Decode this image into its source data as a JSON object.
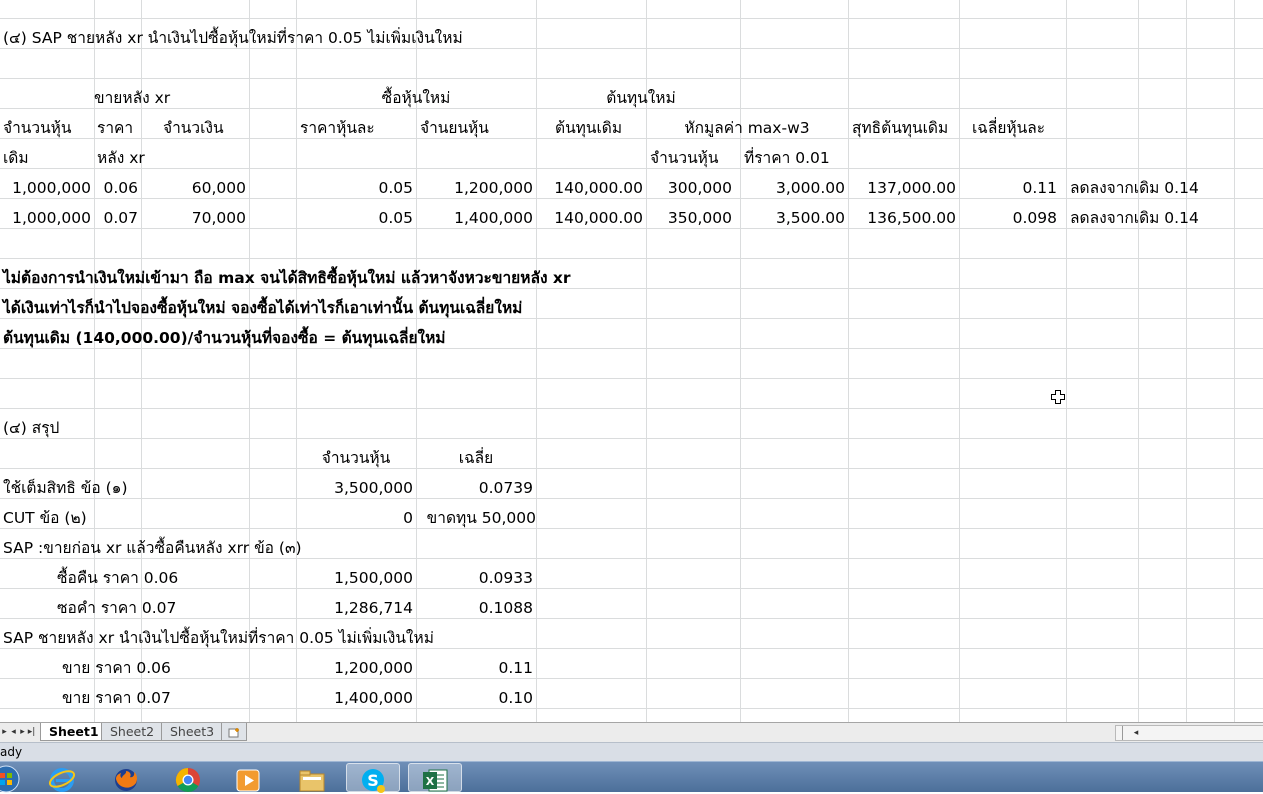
{
  "section4": {
    "title": "(๔) SAP ชายหลัง xr นำเงินไปซื้อหุ้นใหม่ที่ราคา 0.05 ไม่เพิ่มเงินใหม่",
    "group_headers": [
      "ขายหลัง xr",
      "ซื้อหุ้นใหม่",
      "ต้นทุนใหม่"
    ],
    "col_headers": {
      "shares": "จำนวนหุ้น",
      "price": "ราคา",
      "amount": "จำนวเงิน",
      "price_per_share": "ราคาหุ้นละ",
      "share_count": "จำนยนหุ้น",
      "orig_cost": "ต้นทุนเดิม",
      "deduct": "หักมูลค่า max-w3",
      "net_cost": "สุทธิต้นทุนเดิม",
      "avg": "เฉลี่ยหุ้นละ"
    },
    "sub_headers": {
      "orig": "เดิม",
      "after_xr": "หลัง xr",
      "qty": "จำนวนหุ้น",
      "at_price": "ที่ราคา 0.01"
    },
    "rows": [
      {
        "shares": "1,000,000",
        "price": "0.06",
        "amount": "60,000",
        "pps": "0.05",
        "count": "1,200,000",
        "orig": "140,000.00",
        "qty": "300,000",
        "value": "3,000.00",
        "net": "137,000.00",
        "avg": "0.11",
        "note": "ลดลงจากเดิม 0.14"
      },
      {
        "shares": "1,000,000",
        "price": "0.07",
        "amount": "70,000",
        "pps": "0.05",
        "count": "1,400,000",
        "orig": "140,000.00",
        "qty": "350,000",
        "value": "3,500.00",
        "net": "136,500.00",
        "avg": "0.098",
        "note": "ลดลงจากเดิม 0.14"
      }
    ],
    "notes": [
      "ไม่ต้องการนำเงินใหม่เข้ามา ถือ max จนได้สิทธิซื้อหุ้นใหม่ แล้วหาจังหวะขายหลัง xr",
      "ได้เงินเท่าไรก็นำไปจองซื้อหุ้นใหม่ จองซื้อได้เท่าไรก็เอาเท่านั้น ต้นทุนเฉลี่ยใหม่",
      "ต้นทุนเดิม (140,000.00)/จำนวนหุ้นที่จองซื้อ = ต้นทุนเฉลี่ยใหม่"
    ]
  },
  "summary": {
    "title": "(๔) สรุป",
    "col_shares": "จำนวนหุ้น",
    "col_avg": "เฉลี่ย",
    "rows": [
      {
        "label": "ใช้เต็มสิทธิ ข้อ (๑)",
        "shares": "3,500,000",
        "avg": "0.0739",
        "indent": false
      },
      {
        "label": "CUT ข้อ (๒)",
        "shares": "0",
        "avg": "ขาดทุน 50,000",
        "indent": false
      },
      {
        "label": "SAP :ขายก่อน xr แล้วซื้อคืนหลัง xrr ข้อ (๓)",
        "shares": "",
        "avg": "",
        "indent": false
      },
      {
        "label": "ซื้อคืน ราคา 0.06",
        "shares": "1,500,000",
        "avg": "0.0933",
        "indent": true
      },
      {
        "label": "ซอคำ ราคา 0.07",
        "shares": "1,286,714",
        "avg": "0.1088",
        "indent": true
      },
      {
        "label": "SAP ชายหลัง xr นำเงินไปซื้อหุ้นใหม่ที่ราคา 0.05 ไม่เพิ่มเงินใหม่",
        "shares": "",
        "avg": "",
        "indent": false
      },
      {
        "label": "ขาย ราคา 0.06",
        "shares": "1,200,000",
        "avg": "0.11",
        "indent": true
      },
      {
        "label": "ขาย ราคา 0.07",
        "shares": "1,400,000",
        "avg": "0.10",
        "indent": true
      }
    ]
  },
  "sheet_tabs": [
    "Sheet1",
    "Sheet2",
    "Sheet3"
  ],
  "status_text": "ady",
  "taskbar_apps": [
    "windows-start",
    "internet-explorer",
    "firefox",
    "chrome",
    "media-player",
    "file-explorer",
    "skype",
    "excel"
  ],
  "colors": {
    "gridline": "#dadcdd",
    "taskbar": "#5a7aa6",
    "excel_green": "#1e7145"
  }
}
